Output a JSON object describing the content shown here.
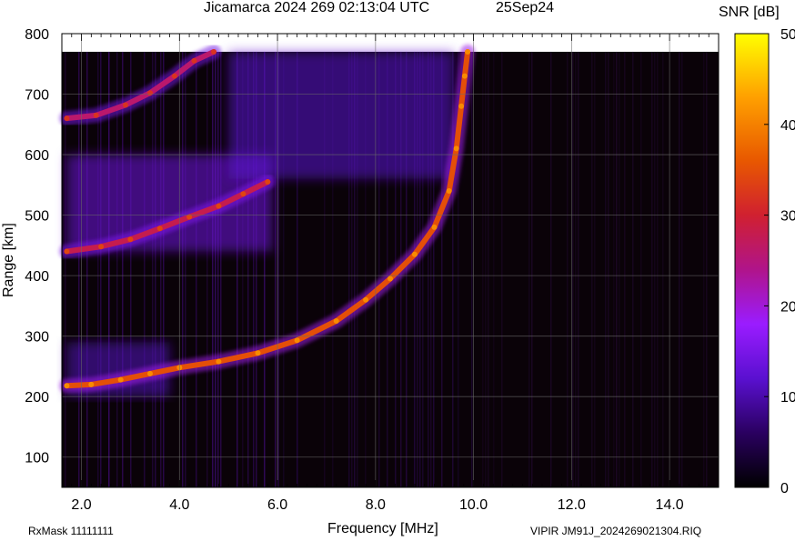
{
  "title": {
    "main": "Jicamarca 2024 269 02:13:04 UTC",
    "date": "25Sep24"
  },
  "footer": {
    "left": "RxMask 11111111",
    "right": "VIPIR  JM91J_2024269021304.RIQ"
  },
  "colorbar": {
    "label": "SNR [dB]",
    "range": [
      0,
      50
    ],
    "ticks": [
      0,
      10,
      20,
      30,
      40,
      50
    ],
    "colors": [
      "#000000",
      "#4a0090",
      "#9a1cff",
      "#cc1060",
      "#e86000",
      "#ffcc00",
      "#ffff00"
    ]
  },
  "chart_data": {
    "type": "heatmap",
    "xlabel": "Frequency [MHz]",
    "ylabel": "Range [km]",
    "xlim": [
      1.6,
      15.0
    ],
    "ylim": [
      50,
      800
    ],
    "xticks": [
      "2.0",
      "4.0",
      "6.0",
      "8.0",
      "10.0",
      "12.0",
      "14.0"
    ],
    "xtick_values": [
      2.0,
      4.0,
      6.0,
      8.0,
      10.0,
      12.0,
      14.0
    ],
    "yticks": [
      100,
      200,
      300,
      400,
      500,
      600,
      700,
      800
    ],
    "grid": true,
    "traces": [
      {
        "label": "",
        "points": [
          [
            1.7,
            218
          ],
          [
            2.2,
            220
          ],
          [
            2.8,
            228
          ],
          [
            3.4,
            238
          ],
          [
            4.0,
            248
          ],
          [
            4.8,
            258
          ],
          [
            5.6,
            272
          ],
          [
            6.4,
            293
          ],
          [
            7.2,
            325
          ],
          [
            7.8,
            360
          ],
          [
            8.3,
            395
          ],
          [
            8.8,
            435
          ],
          [
            9.2,
            480
          ],
          [
            9.5,
            540
          ],
          [
            9.65,
            610
          ],
          [
            9.75,
            680
          ],
          [
            9.82,
            730
          ],
          [
            9.88,
            770
          ]
        ],
        "snr": 35
      },
      {
        "label": "",
        "points": [
          [
            1.7,
            440
          ],
          [
            2.4,
            448
          ],
          [
            3.0,
            460
          ],
          [
            3.6,
            478
          ],
          [
            4.2,
            497
          ],
          [
            4.8,
            515
          ],
          [
            5.3,
            535
          ],
          [
            5.8,
            555
          ]
        ],
        "snr": 28
      },
      {
        "label": "",
        "points": [
          [
            1.7,
            660
          ],
          [
            2.3,
            665
          ],
          [
            2.9,
            682
          ],
          [
            3.4,
            702
          ],
          [
            3.9,
            730
          ],
          [
            4.3,
            755
          ],
          [
            4.7,
            770
          ]
        ],
        "snr": 26
      }
    ],
    "diffuse_regions": [
      {
        "label": "",
        "freq": [
          1.7,
          5.9
        ],
        "range": [
          440,
          600
        ],
        "snr": 14
      },
      {
        "label": "",
        "freq": [
          5.0,
          9.6
        ],
        "range": [
          560,
          770
        ],
        "snr": 12
      },
      {
        "label": "",
        "freq": [
          1.7,
          3.8
        ],
        "range": [
          200,
          290
        ],
        "snr": 11
      }
    ]
  }
}
